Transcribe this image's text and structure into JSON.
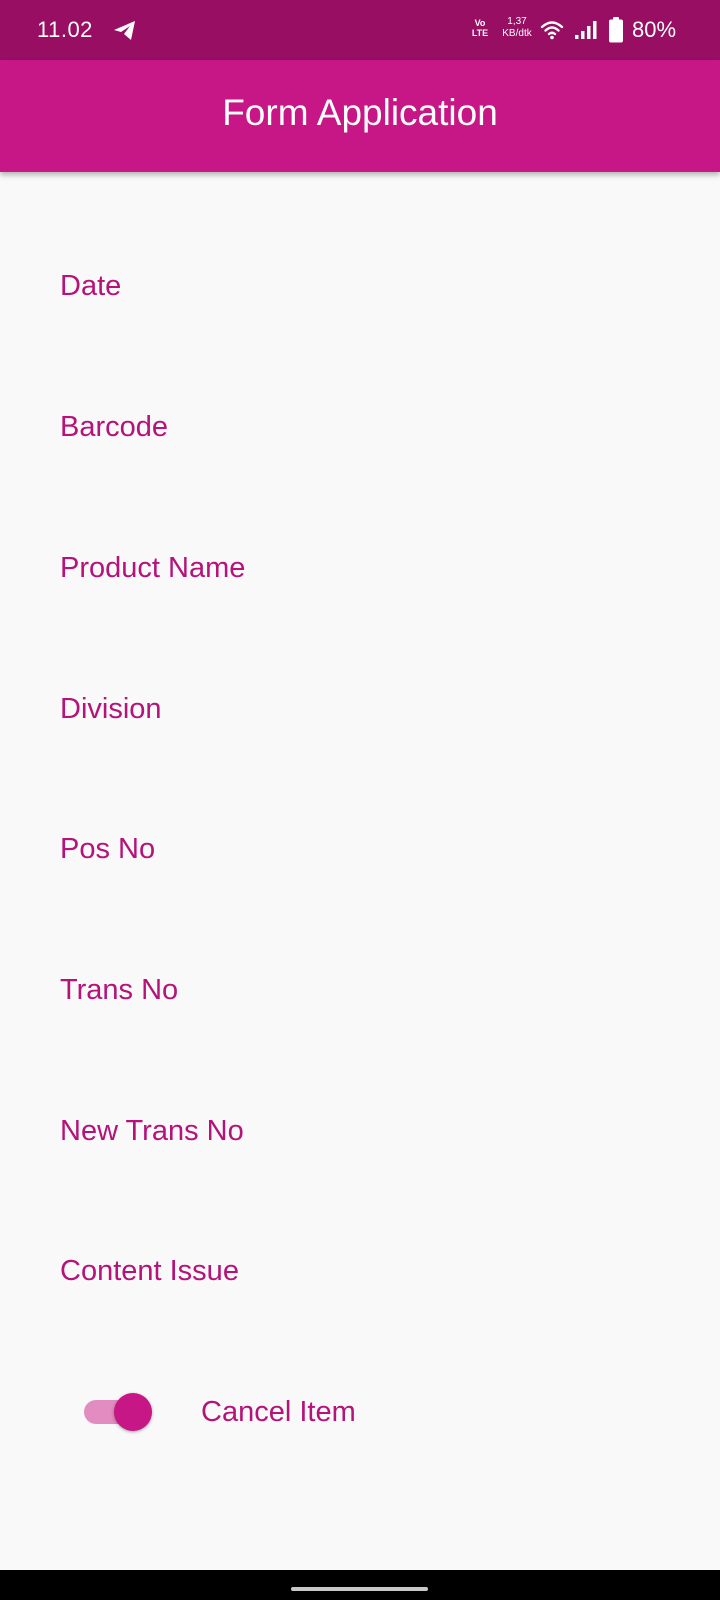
{
  "status_bar": {
    "time": "11.02",
    "volte_top": "Vo",
    "volte_bottom": "LTE",
    "net_speed_value": "1,37",
    "net_speed_unit": "KB/dtk",
    "battery": "80%",
    "icons": [
      "telegram-icon",
      "volte-icon",
      "wifi-icon",
      "signal-icon",
      "battery-icon"
    ]
  },
  "app_bar": {
    "title": "Form Application"
  },
  "form": {
    "fields": [
      {
        "label": "Date"
      },
      {
        "label": "Barcode"
      },
      {
        "label": "Product Name"
      },
      {
        "label": "Division"
      },
      {
        "label": "Pos No"
      },
      {
        "label": "Trans No"
      },
      {
        "label": "New Trans No"
      },
      {
        "label": "Content Issue"
      }
    ],
    "cancel_switch": {
      "label": "Cancel Item",
      "checked": true
    }
  },
  "colors": {
    "status_bar": "#970e62",
    "app_bar": "#c71685",
    "accent_text": "#b5127a",
    "switch_track": "#e38cc1",
    "background": "#f9f9f9"
  }
}
